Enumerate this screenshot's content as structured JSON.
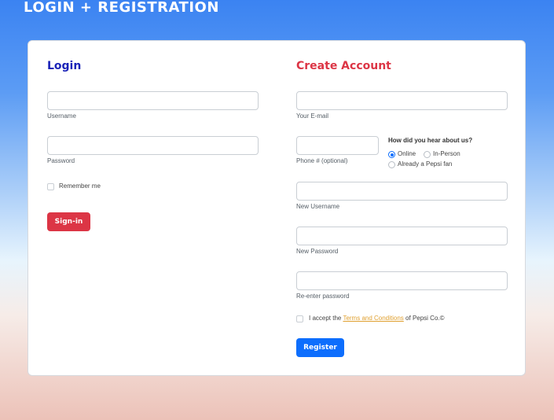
{
  "header": {
    "title": "LOGIN + REGISTRATION"
  },
  "login": {
    "title": "Login",
    "username_label": "Username",
    "password_label": "Password",
    "remember_label": "Remember me",
    "signin_label": "Sign-in"
  },
  "register": {
    "title": "Create Account",
    "email_label": "Your E-mail",
    "phone_label": "Phone # (optional)",
    "hear_question": "How did you hear about us?",
    "hear_options": [
      "Online",
      "In-Person",
      "Already a Pepsi fan"
    ],
    "hear_selected": "Online",
    "new_username_label": "New Username",
    "new_password_label": "New Password",
    "reenter_password_label": "Re-enter password",
    "terms_prefix": "I accept the",
    "terms_link": "Terms and Conditions",
    "terms_suffix": "of Pepsi Co.©",
    "register_label": "Register"
  },
  "colors": {
    "login_title": "#1a23b8",
    "create_title": "#dc3545",
    "signin_button": "#dc3545",
    "register_button": "#0d6efd",
    "terms_link": "#e0a030"
  }
}
